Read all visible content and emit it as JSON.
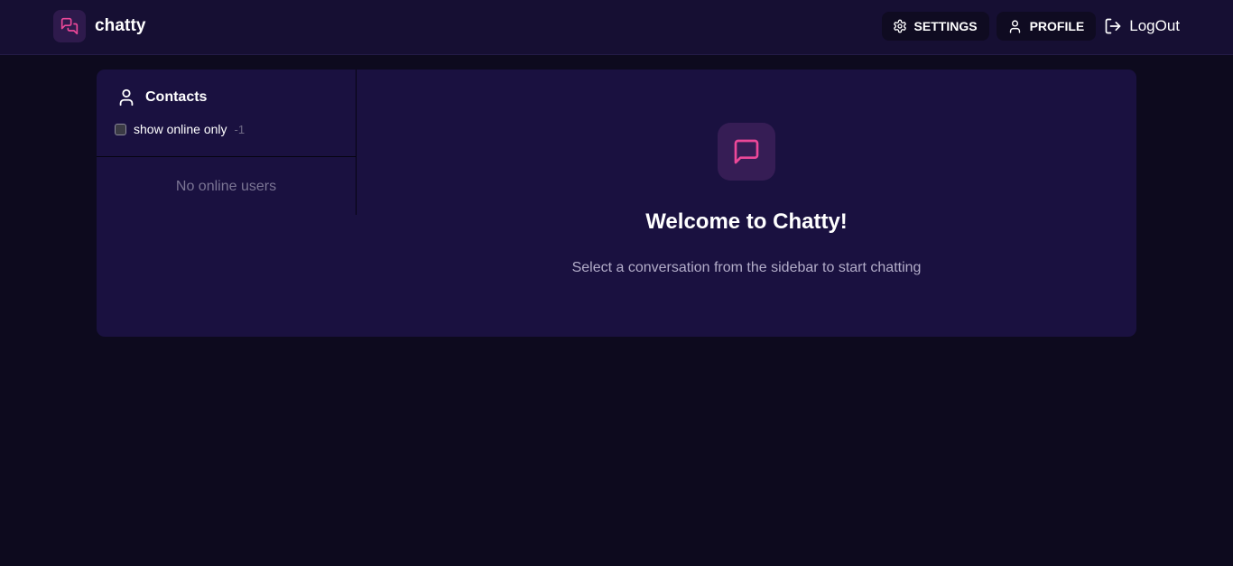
{
  "app": {
    "name": "chatty",
    "accent_color": "#ec4899",
    "logo_icon": "messages-icon"
  },
  "nav": {
    "settings_label": "SETTINGS",
    "profile_label": "PROFILE",
    "logout_label": "LogOut"
  },
  "sidebar": {
    "title": "Contacts",
    "filter_label": "show online only",
    "filter_checked": false,
    "online_count": "-1",
    "empty_text": "No online users"
  },
  "welcome": {
    "title": "Welcome to Chatty!",
    "subtitle": "Select a conversation from the sidebar to start chatting"
  }
}
